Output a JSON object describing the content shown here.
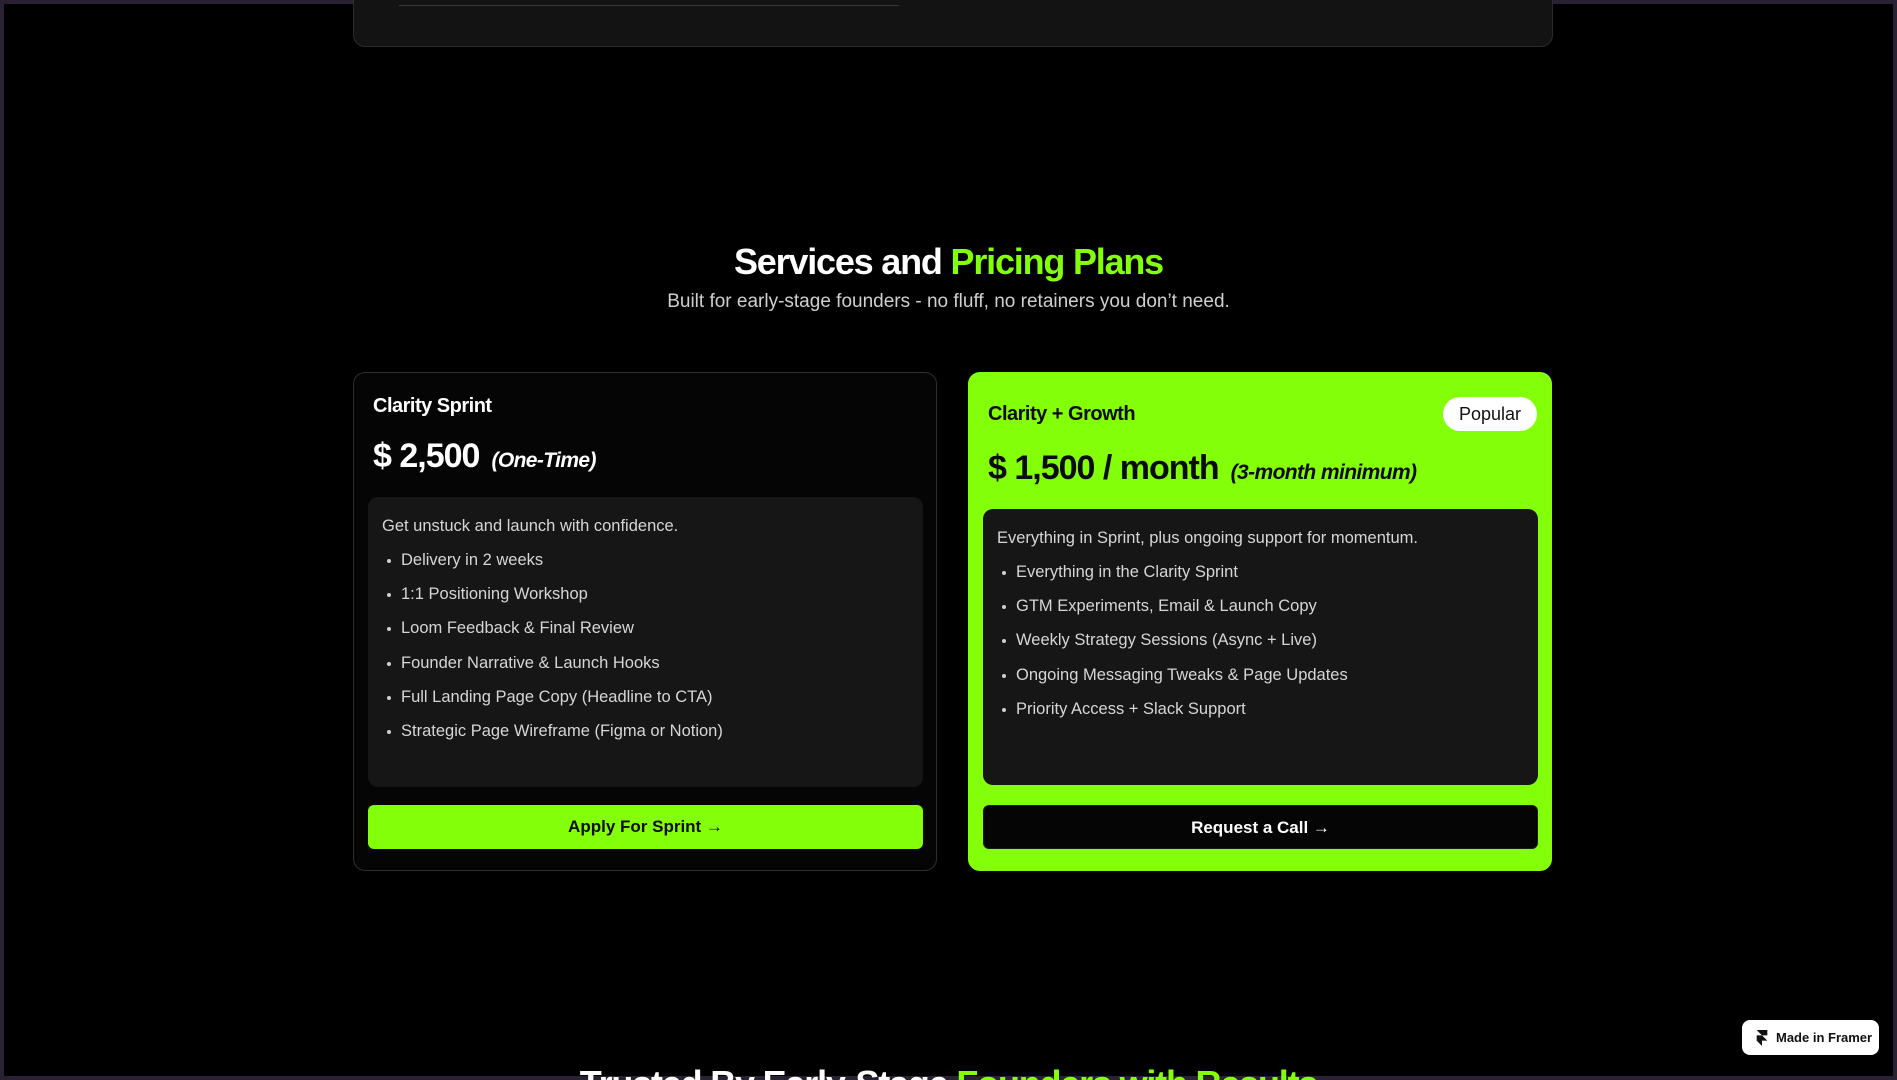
{
  "section": {
    "title_main": "Services and",
    "title_accent": "Pricing Plans",
    "subtitle": "Built for early-stage founders - no fluff, no retainers you don’t need."
  },
  "plans": [
    {
      "name": "Clarity Sprint",
      "price": "$ 2,500",
      "price_note": "(One-Time)",
      "description": "Get unstuck and launch with confidence.",
      "features": [
        "Delivery in 2 weeks",
        "1:1 Positioning Workshop",
        "Loom Feedback & Final Review",
        "Founder Narrative & Launch Hooks",
        "Full Landing Page Copy (Headline to CTA)",
        "Strategic Page Wireframe (Figma or Notion)"
      ],
      "cta_label": "Apply For Sprint →"
    },
    {
      "name": "Clarity + Growth",
      "badge": "Popular",
      "price": "$ 1,500 / month",
      "price_note": "(3-month minimum)",
      "description": "Everything in Sprint, plus ongoing support for momentum.",
      "features": [
        "Everything in the Clarity Sprint",
        "GTM Experiments, Email & Launch Copy",
        "Weekly Strategy Sessions (Async + Live)",
        "Ongoing Messaging Tweaks & Page Updates",
        "Priority Access + Slack Support"
      ],
      "cta_label": "Request a Call →"
    }
  ],
  "next_section": {
    "title_main": "Trusted By Early-Stage",
    "title_accent": "Founders with Results"
  },
  "framer_badge": {
    "label": "Made in Framer",
    "icon": "framer-logo-icon"
  },
  "colors": {
    "accent": "#84ff0a",
    "background": "#000000",
    "card_inner": "#161616"
  }
}
